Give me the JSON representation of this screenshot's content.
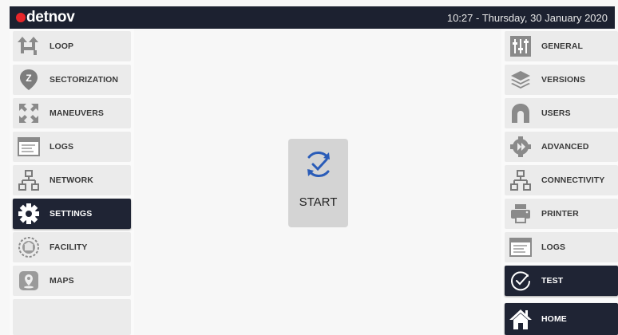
{
  "header": {
    "brand": "detnov",
    "datetime": "10:27 - Thursday, 30 January 2020"
  },
  "left_menu": [
    {
      "label": "LOOP",
      "icon": "loop-arrows-icon",
      "active": false
    },
    {
      "label": "SECTORIZATION",
      "icon": "zone-pin-icon",
      "active": false
    },
    {
      "label": "MANEUVERS",
      "icon": "maneuvers-icon",
      "active": false
    },
    {
      "label": "LOGS",
      "icon": "logs-window-icon",
      "active": false
    },
    {
      "label": "NETWORK",
      "icon": "network-icon",
      "active": false
    },
    {
      "label": "SETTINGS",
      "icon": "gear-icon",
      "active": true
    },
    {
      "label": "FACILITY",
      "icon": "facility-icon",
      "active": false
    },
    {
      "label": "MAPS",
      "icon": "map-pin-icon",
      "active": false
    }
  ],
  "right_menu": [
    {
      "label": "GENERAL",
      "icon": "sliders-icon",
      "active": false
    },
    {
      "label": "VERSIONS",
      "icon": "layers-icon",
      "active": false
    },
    {
      "label": "USERS",
      "icon": "user-icon",
      "active": false
    },
    {
      "label": "ADVANCED",
      "icon": "advanced-gear-icon",
      "active": false
    },
    {
      "label": "CONNECTIVITY",
      "icon": "connectivity-icon",
      "active": false
    },
    {
      "label": "PRINTER",
      "icon": "printer-icon",
      "active": false
    },
    {
      "label": "LOGS",
      "icon": "logs-window-icon",
      "active": false
    },
    {
      "label": "TEST",
      "icon": "test-check-icon",
      "active": true
    },
    {
      "label": "HOME",
      "icon": "home-icon",
      "active": true
    }
  ],
  "start": {
    "label": "START",
    "icon": "start-check-icon"
  },
  "colors": {
    "brand_red": "#e8262a",
    "dark": "#1c2130",
    "accent_blue": "#2a5cb8"
  }
}
